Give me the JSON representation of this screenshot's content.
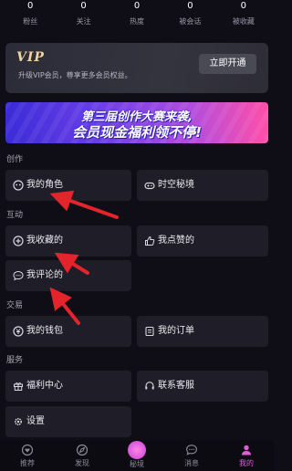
{
  "stats": [
    {
      "value": "0",
      "label": "粉丝"
    },
    {
      "value": "0",
      "label": "关注"
    },
    {
      "value": "0",
      "label": "热度"
    },
    {
      "value": "0",
      "label": "被会话"
    },
    {
      "value": "0",
      "label": "被收藏"
    }
  ],
  "vip": {
    "logo": "VIP",
    "description": "升级VIP会员，尊享更多会员权益。",
    "button": "立即开通"
  },
  "banner": {
    "line1": "第三届创作大赛来袭,",
    "line2": "会员现金福利领不停!"
  },
  "sections": {
    "create": "创作",
    "interact": "互动",
    "trade": "交易",
    "service": "服务"
  },
  "tiles": {
    "my_roles": "我的角色",
    "time_realm": "时空秘境",
    "my_favorites": "我收藏的",
    "my_likes": "我点赞的",
    "my_comments": "我评论的",
    "my_wallet": "我的钱包",
    "my_orders": "我的订单",
    "welfare_center": "福利中心",
    "contact_support": "联系客服",
    "settings": "设置"
  },
  "nav": {
    "recommend": "推荐",
    "discover": "发现",
    "secret": "秘境",
    "messages": "消息",
    "mine": "我的"
  },
  "colors": {
    "background": "#0f0d16",
    "tile": "#1f1d27",
    "accent": "#e55bd7",
    "arrow": "#e3242b",
    "vip_gold": "#efd6a3"
  }
}
